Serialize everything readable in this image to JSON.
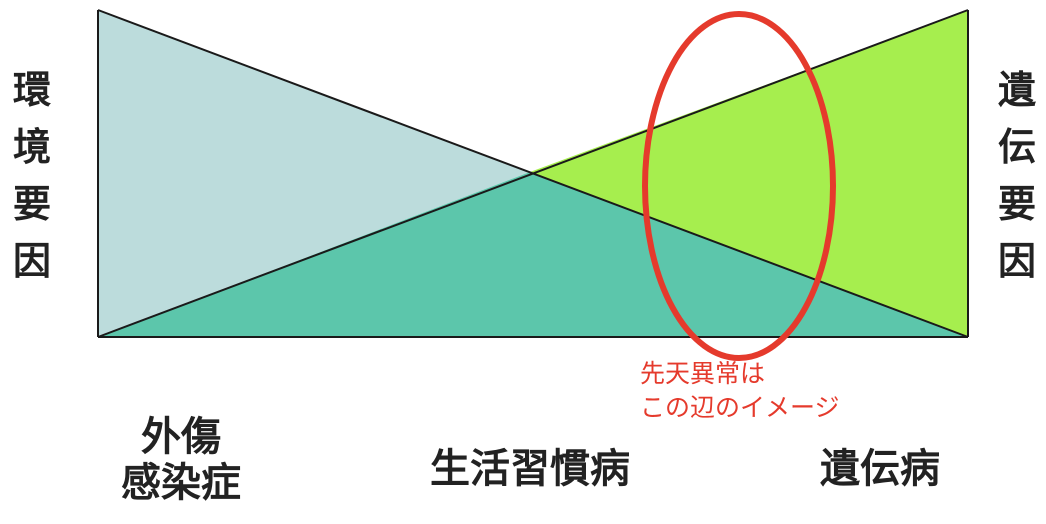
{
  "left_axis_label": "環\n境\n要\n因",
  "right_axis_label": "遺\n伝\n要\n因",
  "categories": {
    "trauma_infection": "外傷\n感染症",
    "lifestyle_disease": "生活習慣病",
    "genetic_disease": "遺伝病"
  },
  "annotation": "先天異常は\nこの辺のイメージ",
  "colors": {
    "environmental_region": "#bcdcdc",
    "genetic_region": "#a6ee4e",
    "overlap_region": "#5cc6ab",
    "highlight_ellipse": "#e53a2c",
    "outline": "#1a1a1a"
  }
}
